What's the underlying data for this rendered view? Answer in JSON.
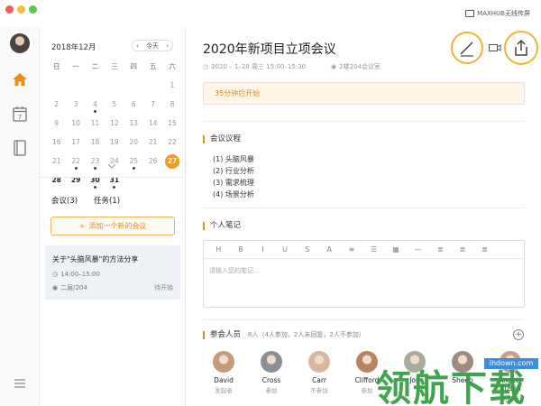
{
  "titlebar": {
    "cast_label": "MAXHUB无线传屏"
  },
  "calendar": {
    "month_label": "2018年12月",
    "today_button": "今天",
    "weekdays": [
      "日",
      "一",
      "二",
      "三",
      "四",
      "五",
      "六"
    ],
    "weeks": [
      [
        {
          "d": "2",
          "dot": true
        },
        {
          "d": "3",
          "dot": false
        },
        {
          "d": "4",
          "dot": false
        },
        {
          "d": "5",
          "dot": false
        },
        {
          "d": "6",
          "dot": false
        },
        {
          "d": "7",
          "dot": false
        },
        {
          "d": "8",
          "dot": false
        }
      ],
      [
        {
          "d": "9",
          "dot": false
        },
        {
          "d": "10",
          "dot": false
        },
        {
          "d": "11",
          "dot": true
        },
        {
          "d": "12",
          "dot": false
        },
        {
          "d": "13",
          "dot": false
        },
        {
          "d": "14",
          "dot": false
        },
        {
          "d": "15",
          "dot": false
        }
      ],
      [
        {
          "d": "16",
          "dot": false
        },
        {
          "d": "17",
          "dot": false
        },
        {
          "d": "18",
          "dot": true
        },
        {
          "d": "19",
          "dot": true
        },
        {
          "d": "20",
          "dot": false
        },
        {
          "d": "21",
          "dot": false
        },
        {
          "d": "22",
          "dot": false
        }
      ],
      [
        {
          "d": "23",
          "dot": false
        },
        {
          "d": "24",
          "dot": false
        },
        {
          "d": "25",
          "dot": false
        },
        {
          "d": "26",
          "dot": false
        },
        {
          "d": "27",
          "dot": false
        },
        {
          "d": "28",
          "dot": false
        },
        {
          "d": "29",
          "dot": false
        }
      ]
    ],
    "row1_prefix": [
      "",
      "",
      "",
      "",
      "",
      "",
      "1"
    ],
    "rows_full": [
      [
        "",
        "",
        "",
        "",
        "",
        "",
        "1"
      ],
      [
        "2",
        "3",
        "4",
        "5",
        "6",
        "7",
        "8"
      ],
      [
        "9",
        "10",
        "11",
        "12",
        "13",
        "14",
        "15"
      ],
      [
        "16",
        "17",
        "18",
        "19",
        "20",
        "21",
        "22"
      ],
      [
        "23",
        "24",
        "25",
        "26",
        "27",
        "28",
        "29"
      ]
    ]
  },
  "cal_rows": [
    [
      {
        "d": "",
        "dot": false,
        "cur": false
      },
      {
        "d": "",
        "dot": false,
        "cur": false
      },
      {
        "d": "",
        "dot": false,
        "cur": false
      },
      {
        "d": "",
        "dot": false,
        "cur": false
      },
      {
        "d": "",
        "dot": false,
        "cur": false
      },
      {
        "d": "",
        "dot": false,
        "cur": false
      },
      {
        "d": "1",
        "dot": false,
        "cur": false
      }
    ],
    [
      {
        "d": "2",
        "dot": false,
        "cur": false
      },
      {
        "d": "3",
        "dot": false,
        "cur": false
      },
      {
        "d": "4",
        "dot": true,
        "cur": false
      },
      {
        "d": "5",
        "dot": false,
        "cur": false
      },
      {
        "d": "6",
        "dot": false,
        "cur": false
      },
      {
        "d": "7",
        "dot": false,
        "cur": false
      },
      {
        "d": "8",
        "dot": false,
        "cur": false
      }
    ],
    [
      {
        "d": "9",
        "dot": false,
        "cur": false
      },
      {
        "d": "10",
        "dot": false,
        "cur": false
      },
      {
        "d": "11",
        "dot": false,
        "cur": false
      },
      {
        "d": "12",
        "dot": false,
        "cur": false
      },
      {
        "d": "13",
        "dot": false,
        "cur": false
      },
      {
        "d": "14",
        "dot": false,
        "cur": false
      },
      {
        "d": "15",
        "dot": false,
        "cur": false
      }
    ],
    [
      {
        "d": "16",
        "dot": false,
        "cur": false
      },
      {
        "d": "17",
        "dot": false,
        "cur": false
      },
      {
        "d": "18",
        "dot": false,
        "cur": false
      },
      {
        "d": "19",
        "dot": false,
        "cur": false
      },
      {
        "d": "20",
        "dot": false,
        "cur": false
      },
      {
        "d": "21",
        "dot": false,
        "cur": false
      },
      {
        "d": "22",
        "dot": false,
        "cur": false
      }
    ],
    [
      {
        "d": "23",
        "dot": false,
        "cur": false
      },
      {
        "d": "24",
        "dot": false,
        "cur": false
      },
      {
        "d": "25",
        "dot": true,
        "cur": false
      },
      {
        "d": "26",
        "dot": true,
        "cur": false
      },
      {
        "d": "27",
        "dot": false,
        "cur": false
      },
      {
        "d": "28",
        "dot": false,
        "cur": false
      },
      {
        "d": "29",
        "dot": false,
        "cur": false
      }
    ],
    [
      {
        "d": "21",
        "dot": false,
        "cur": false
      },
      {
        "d": "22",
        "dot": true,
        "cur": false
      },
      {
        "d": "23",
        "dot": true,
        "cur": false
      },
      {
        "d": "24",
        "dot": false,
        "cur": false
      },
      {
        "d": "25",
        "dot": true,
        "cur": false
      },
      {
        "d": "26",
        "dot": false,
        "cur": false
      },
      {
        "d": "27",
        "dot": true,
        "cur": true,
        "today": true
      }
    ],
    [
      {
        "d": "28",
        "dot": false,
        "cur": true
      },
      {
        "d": "29",
        "dot": false,
        "cur": true
      },
      {
        "d": "30",
        "dot": true,
        "cur": true
      },
      {
        "d": "31",
        "dot": true,
        "cur": true
      },
      {
        "d": "",
        "dot": false,
        "cur": false
      },
      {
        "d": "",
        "dot": false,
        "cur": false
      },
      {
        "d": "",
        "dot": false,
        "cur": false
      }
    ]
  ],
  "list": {
    "tab_meetings": "会议(3)",
    "tab_tasks": "任务(1)",
    "add_button": "添加一个新的会议",
    "card": {
      "title": "关于\"头脑风暴\"的方法分享",
      "time": "14:00–15:00",
      "room": "二层/204",
      "status": "待开始"
    }
  },
  "meeting": {
    "title": "2020年新项目立项会议",
    "datetime": "2020 – 1–28 周三 15:00–15:30",
    "location": "2楼204会议室",
    "notice": "35分钟后开始",
    "agenda_label": "会议议程",
    "agenda": [
      "(1) 头脑风暴",
      "(2) 行业分析",
      "(3) 需求梳理",
      "(4) 场景分析"
    ],
    "notes_label": "个人笔记",
    "toolbar": [
      "H",
      "B",
      "I",
      "U",
      "S",
      "A",
      "≡",
      "☰",
      "▦",
      "—",
      "≣",
      "≣",
      "≣"
    ],
    "notes_placeholder": "请输入您的笔记...",
    "attendees_label": "参会人员",
    "attendees_count": "8人（4人参加，2人未回复，2人不参加）",
    "attendees": [
      {
        "name": "David",
        "status": "发起者",
        "color": "#c49a7a"
      },
      {
        "name": "Cross",
        "status": "参加",
        "color": "#8a8f95"
      },
      {
        "name": "Carr",
        "status": "不参加",
        "color": "#d7b7a0"
      },
      {
        "name": "Clifford",
        "status": "参加",
        "color": "#b88563"
      },
      {
        "name": "Jon",
        "status": "",
        "color": "#a6ad98"
      },
      {
        "name": "Sheep",
        "status": "",
        "color": "#9e8c7f"
      },
      {
        "name": "Angelo Austin",
        "status": "待回复",
        "color": "#c7a089"
      }
    ]
  },
  "watermark": {
    "text": "领航下载",
    "url": "ihdown.com"
  },
  "colors": {
    "accent": "#f08c1a",
    "today": "#f39a1d",
    "card_bg": "#eef1f5"
  }
}
